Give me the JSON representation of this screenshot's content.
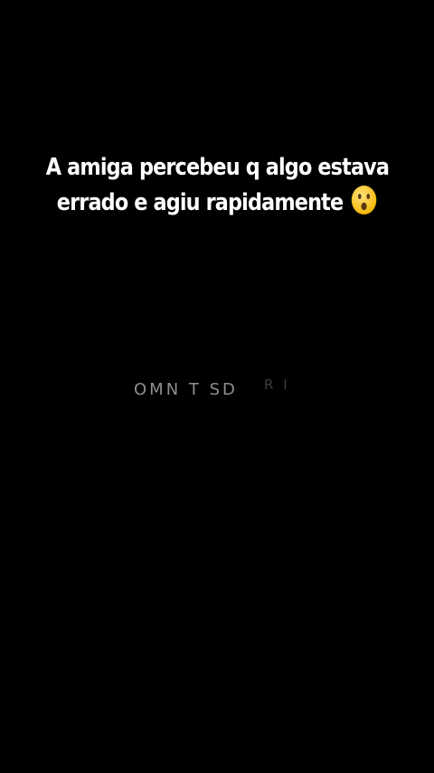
{
  "caption": {
    "line1": "A amiga percebeu q algo estava",
    "line2": "errado e agiu rapidamente"
  },
  "emoji_icon": "surprised-face-icon",
  "watermark": {
    "text": "OMN T SD",
    "faded_text": "R I"
  },
  "colors": {
    "background": "#000000",
    "caption_text": "#ffffff",
    "watermark": "#8e8e8e"
  }
}
